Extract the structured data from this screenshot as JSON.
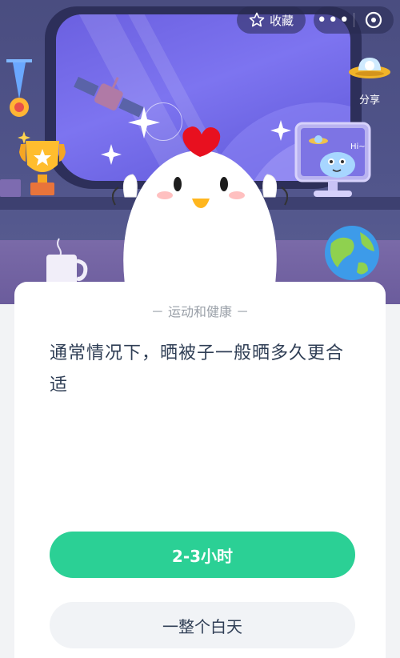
{
  "header": {
    "favorite_label": "收藏",
    "more_label": "•••",
    "share_label": "分享"
  },
  "illustration": {
    "monitor_text": "Hi~"
  },
  "quiz": {
    "category": "－ 运动和健康 －",
    "question": "通常情况下，晒被子一般晒多久更合适",
    "answers": [
      {
        "label": "2-3小时",
        "highlighted": true
      },
      {
        "label": "一整个白天",
        "highlighted": false
      }
    ]
  },
  "colors": {
    "accent_green": "#2bd095",
    "question_text": "#2f3e55",
    "category_text": "#9aa0a8",
    "scene_purple": "#4a4d80"
  }
}
